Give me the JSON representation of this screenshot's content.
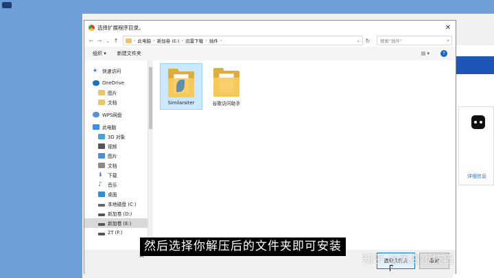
{
  "dialog": {
    "title": "选择扩展程序目录。",
    "close_glyph": "✕",
    "nav": {
      "back": "←",
      "forward": "→",
      "recent": "⌄",
      "up": "↑",
      "refresh": "↻"
    },
    "breadcrumb": [
      "此电脑",
      "新加卷 (E:)",
      "迅雷下载",
      "插件"
    ],
    "crumb_sep": "›",
    "search_placeholder": "搜索\"插件\"",
    "toolbar": {
      "organize": "组织 ▾",
      "new_folder": "新建文件夹",
      "help": "?"
    },
    "sidebar": [
      {
        "label": "快速访问",
        "icon": "star-icon",
        "color": "#2b78d4",
        "indent": 0
      },
      {
        "label": "OneDrive",
        "icon": "cloud-icon",
        "color": "#1e73be",
        "indent": 0
      },
      {
        "label": "图片",
        "icon": "folder-icon",
        "color": "#e9c46a",
        "indent": 1
      },
      {
        "label": "文档",
        "icon": "folder-icon",
        "color": "#e9c46a",
        "indent": 1
      },
      {
        "label": "WPS网盘",
        "icon": "cloud-icon",
        "color": "#5b8fd6",
        "indent": 0
      },
      {
        "label": "此电脑",
        "icon": "computer-icon",
        "color": "#3a8ee6",
        "indent": 0
      },
      {
        "label": "3D 对象",
        "icon": "cube-icon",
        "color": "#45a7d8",
        "indent": 1
      },
      {
        "label": "视频",
        "icon": "video-icon",
        "color": "#555555",
        "indent": 1
      },
      {
        "label": "图片",
        "icon": "picture-icon",
        "color": "#4b8fd1",
        "indent": 1
      },
      {
        "label": "文档",
        "icon": "document-icon",
        "color": "#8a8a8a",
        "indent": 1
      },
      {
        "label": "下载",
        "icon": "download-icon",
        "color": "#2b78d4",
        "indent": 1
      },
      {
        "label": "音乐",
        "icon": "music-icon",
        "color": "#2b78d4",
        "indent": 1
      },
      {
        "label": "桌面",
        "icon": "desktop-icon",
        "color": "#2b8fd4",
        "indent": 1
      },
      {
        "label": "本地磁盘 (C:)",
        "icon": "drive-icon",
        "color": "#666666",
        "indent": 1
      },
      {
        "label": "新加卷 (D:)",
        "icon": "drive-icon",
        "color": "#555555",
        "indent": 1
      },
      {
        "label": "新加卷 (E:)",
        "icon": "drive-icon",
        "color": "#555555",
        "indent": 1,
        "selected": true
      },
      {
        "label": "2T (F:)",
        "icon": "drive-icon",
        "color": "#555555",
        "indent": 1
      }
    ],
    "files": [
      {
        "name": "Similarsiter",
        "selected": true
      },
      {
        "name": "谷歌访问助手",
        "selected": false
      }
    ],
    "footer": {
      "filename_label": "文",
      "select_button": "选择文件夹",
      "cancel_button": "取消"
    }
  },
  "background": {
    "detail_link": "详细信息"
  },
  "overlay": {
    "subtitle": "然后选择你解压后的文件夹即可安装",
    "watermark": "知乎 @黑白小技巧"
  }
}
